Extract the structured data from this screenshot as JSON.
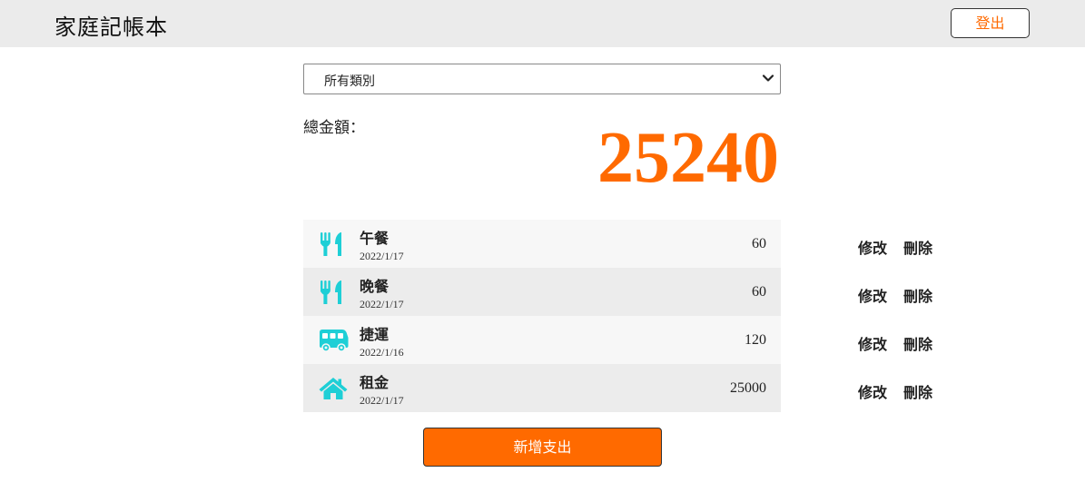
{
  "app": {
    "title": "家庭記帳本",
    "logout_label": "登出"
  },
  "filter": {
    "selected": "所有類別",
    "icon": "chevron-down-icon"
  },
  "summary": {
    "label": "總金額：",
    "total": "25240"
  },
  "colors": {
    "accent": "#ff6a00",
    "icon": "#1ecfd6"
  },
  "expenses": [
    {
      "name": "午餐",
      "date": "2022/1/17",
      "amount": "60",
      "icon": "utensils-icon",
      "edit_label": "修改",
      "delete_label": "刪除"
    },
    {
      "name": "晚餐",
      "date": "2022/1/17",
      "amount": "60",
      "icon": "utensils-icon",
      "edit_label": "修改",
      "delete_label": "刪除"
    },
    {
      "name": "捷運",
      "date": "2022/1/16",
      "amount": "120",
      "icon": "bus-icon",
      "edit_label": "修改",
      "delete_label": "刪除"
    },
    {
      "name": "租金",
      "date": "2022/1/17",
      "amount": "25000",
      "icon": "home-icon",
      "edit_label": "修改",
      "delete_label": "刪除"
    }
  ],
  "add_button": {
    "label": "新增支出"
  }
}
